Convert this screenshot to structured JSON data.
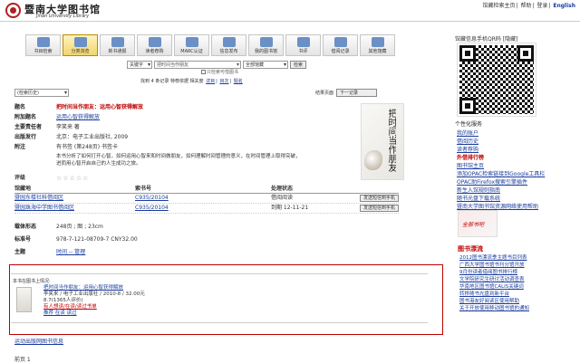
{
  "header": {
    "logo_cn": "暨南大学图书馆",
    "logo_en": "Jinan University Library",
    "links": [
      "馆藏检索主页",
      "帮助",
      "登录",
      "English"
    ]
  },
  "toolbar": {
    "buttons": [
      {
        "label": "书目检索",
        "active": false
      },
      {
        "label": "分类浏览",
        "active": true
      },
      {
        "label": "新书通报",
        "active": false
      },
      {
        "label": "读者荐购",
        "active": false
      },
      {
        "label": "MARC认证",
        "active": false
      },
      {
        "label": "信息发布",
        "active": false
      },
      {
        "label": "我的图书馆",
        "active": false
      },
      {
        "label": "书评",
        "active": false
      },
      {
        "label": "借阅记录",
        "active": false
      },
      {
        "label": "其他馆藏",
        "active": false
      }
    ]
  },
  "search": {
    "field_select": "关键字",
    "query_placeholder": "把时间当作朋友",
    "scope_select": "全部馆藏",
    "search_button": "检索",
    "checkbox_label": "只检索可借图书"
  },
  "banner": {
    "prefix": "找到 4 条记录 特荐依据 相关度",
    "links": [
      "详目",
      "目次",
      "题名"
    ]
  },
  "left_select": "(检索历史)",
  "result_nav": {
    "label": "结果页面",
    "button": "下一记录"
  },
  "details": [
    {
      "key": "题名",
      "value": "把时间当作朋友：运用心智获得解放",
      "style": "red"
    },
    {
      "key": "附加题名",
      "value": "运用心智获得解放",
      "style": "link"
    },
    {
      "key": "主要责任者",
      "value": "李笑来 著",
      "style": "plain"
    },
    {
      "key": "出版发行",
      "value": "北京：电子工业出版社, 2009",
      "style": "plain"
    },
    {
      "key": "附注",
      "value": "有书签 (第248页) 书签卡",
      "style": "plain"
    },
    {
      "key": "",
      "value": "本书分析了如何打开心智，如何运用心智来和时间做朋友，如何理解时间管理的意义，在时间管理上取得突破，进而用心智开启自己的人生成功之旅。",
      "style": "plain"
    }
  ],
  "cover_title": "把时间当作朋友",
  "rating": {
    "label": "评级",
    "stars": "☆☆☆☆☆"
  },
  "holdings": {
    "headers": [
      "馆藏地",
      "索书号",
      "处理状态",
      ""
    ],
    "rows": [
      {
        "location": "暨园东楼社科借阅区",
        "callno": "C935/20104",
        "status": "借阅阅读",
        "action": "发送短信到手机"
      },
      {
        "location": "暨园珠海中学图书借阅区",
        "callno": "C935/20104",
        "status": "到期 12-11-21",
        "action": "发送短信到手机"
      }
    ]
  },
  "details2": [
    {
      "key": "载体形态",
      "value": "248页 ; 图 ; 23cm"
    },
    {
      "key": "标准号",
      "value": "978-7-121-08709-7 CNY32.00"
    },
    {
      "key": "主题",
      "value": "时间 -- 管理"
    }
  ],
  "related": {
    "title": "本书在图书上情况:",
    "book_title": "把时间当作朋友：运用心智获得解放",
    "meta": "李笑来 / 电子工业出版社 / 2010-8 / 32.00元",
    "rating": "8.7(1365人评价)",
    "red_link": "有人想读/在读/读过书单",
    "actions": "推荐   在读   读过"
  },
  "subject_link": "运动出版网图书信息",
  "page_label": "前页 1",
  "sidebar": {
    "qr_label": "馆藏信息手机QR码 [隐藏]",
    "service_head": "个性化服务",
    "services": [
      "我的账户",
      "借阅历史",
      "读者荐购",
      "外借排行榜",
      "图书馆主页",
      "添加OPAC检索链接到Google工具栏",
      "OPAC助Firefox搜索引擎插件",
      "新生入馆规则指南",
      "随书光盘下载系统",
      "暨南大学图书馆资源网络使用帮助"
    ],
    "hot_index": 3,
    "box_text": "全部书吧",
    "new_head": "图书漂流",
    "new_items": [
      "2012图书漂流季主题书目列表",
      "广西大学图书馆书刊分馆开放",
      "9月份读者借阅图书排行榜",
      "文学院研究生研讨活动调查表",
      "华南地区图书馆CALIS关键词",
      "转移随书光盘到新平台",
      "图书港友好阅读区使用帮助",
      "关于开放使用移动图书馆的通知"
    ]
  }
}
